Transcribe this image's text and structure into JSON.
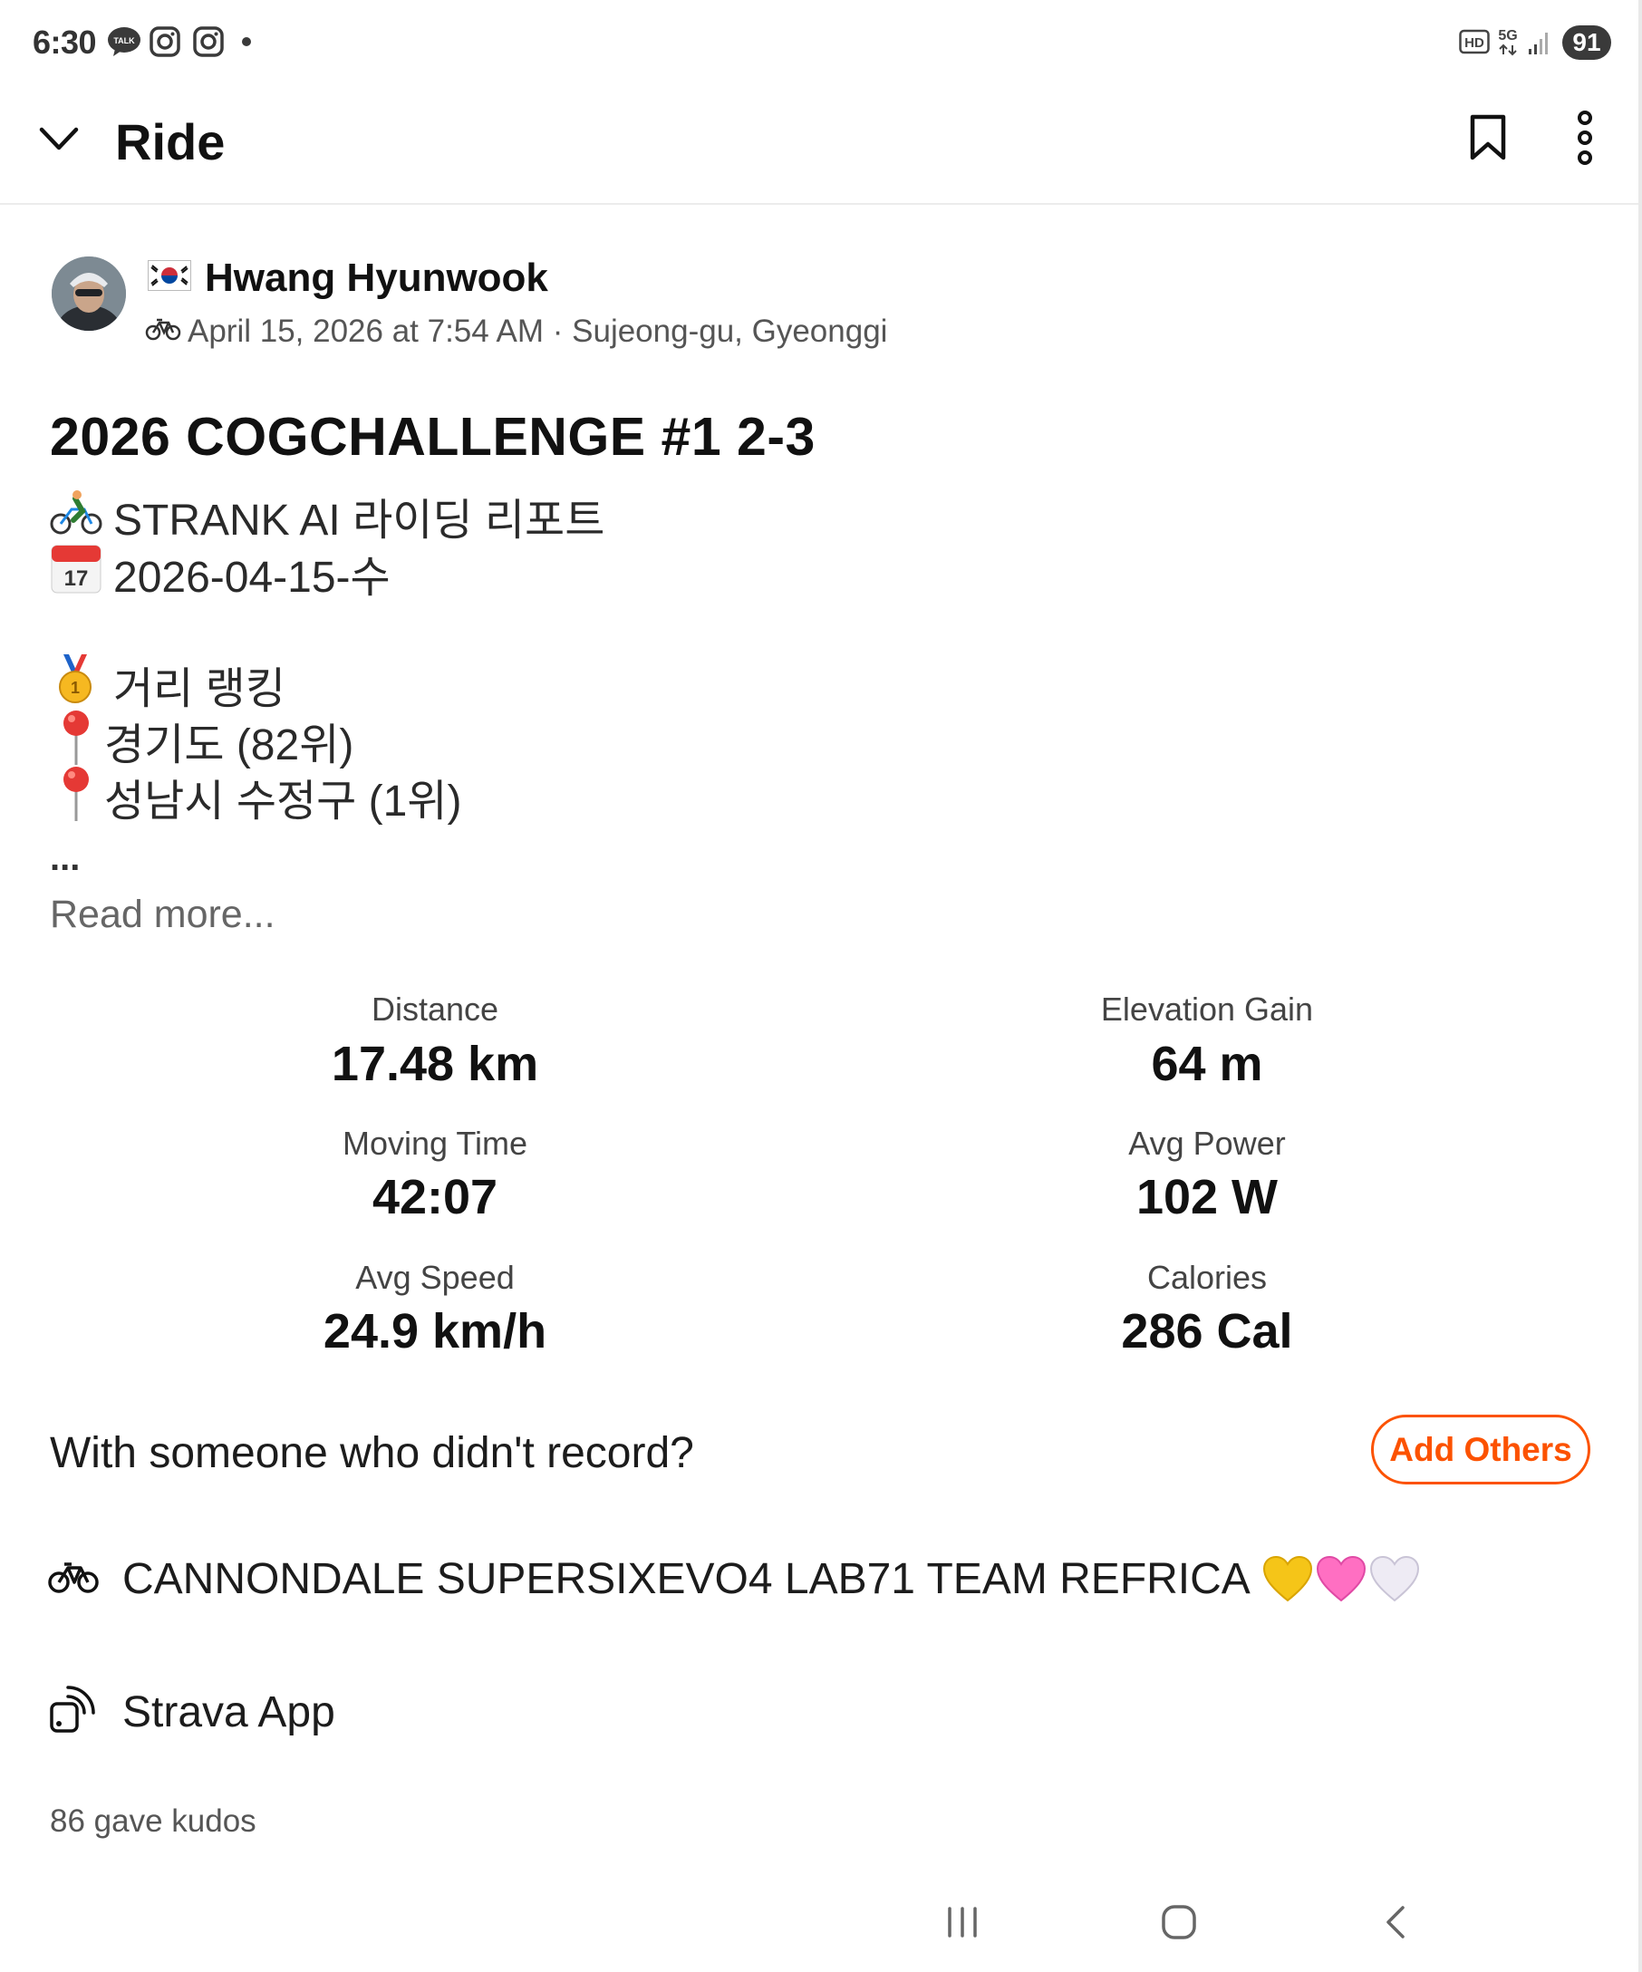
{
  "status_bar": {
    "time": "6:30",
    "notification_icons": [
      "talk-icon",
      "instagram-icon",
      "instagram-icon",
      "dot-icon"
    ],
    "right_icons": [
      "hd-icon",
      "5g-icon",
      "signal-icon"
    ],
    "battery": "91"
  },
  "header": {
    "title": "Ride",
    "icons": [
      "chevron-down-icon",
      "bookmark-icon",
      "more-vertical-icon"
    ]
  },
  "author": {
    "name": "Hwang Hyunwook",
    "flag": "korea-flag-icon",
    "meta": "April 15, 2026 at 7:54 AM · Sujeong-gu, Gyeonggi"
  },
  "activity": {
    "title": "2026 COGCHALLENGE #1 2-3",
    "desc_lines": [
      "STRANK AI 라이딩 리포트",
      "2026-04-15-수",
      "거리 랭킹",
      "경기도 (82위)",
      "성남시 수정구 (1위)"
    ],
    "ellipsis": "...",
    "read_more": "Read more..."
  },
  "stats": [
    {
      "label": "Distance",
      "value": "17.48 km"
    },
    {
      "label": "Elevation Gain",
      "value": "64 m"
    },
    {
      "label": "Moving Time",
      "value": "42:07"
    },
    {
      "label": "Avg Power",
      "value": "102 W"
    },
    {
      "label": "Avg Speed",
      "value": "24.9 km/h"
    },
    {
      "label": "Calories",
      "value": "286 Cal"
    }
  ],
  "with_others": {
    "text": "With someone who didn't record?",
    "button": "Add Others"
  },
  "gear": {
    "text": "CANNONDALE SUPERSIXEVO4 LAB71 TEAM REFRICA",
    "hearts": [
      "#f5c518",
      "#ff6fc2",
      "#e4e0ee"
    ]
  },
  "device": {
    "text": "Strava App"
  },
  "kudos": {
    "text": "86 gave kudos"
  },
  "colors": {
    "accent": "#fc5200"
  }
}
